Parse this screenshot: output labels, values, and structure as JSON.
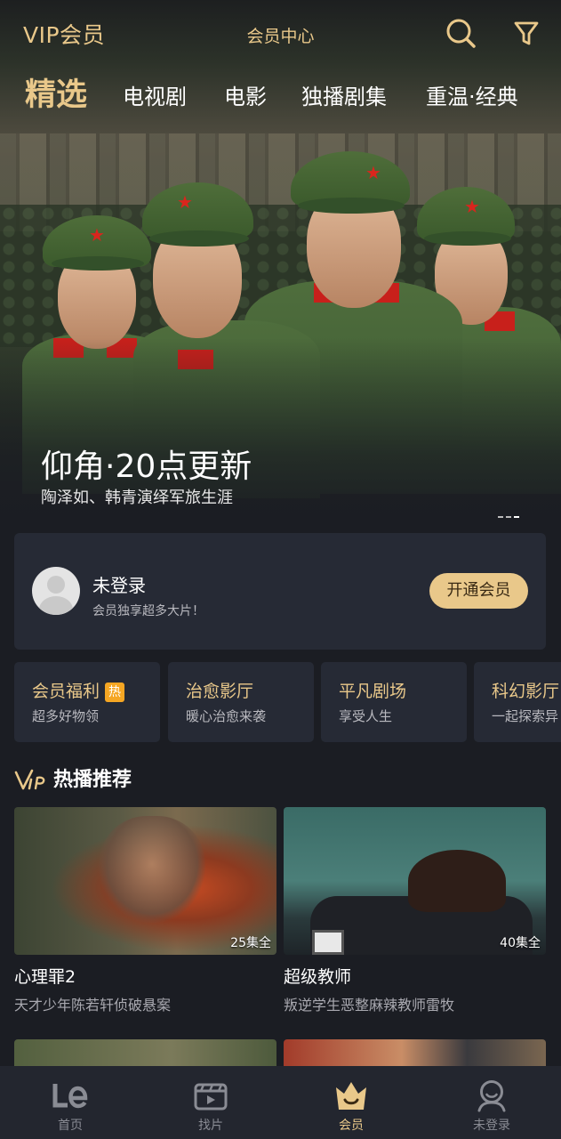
{
  "header": {
    "title": "VIP会员",
    "center_link": "会员中心",
    "search_icon": "search-icon",
    "filter_icon": "filter-icon",
    "accent_color": "#e9c88a"
  },
  "tabs": [
    {
      "label": "精选",
      "active": true
    },
    {
      "label": "电视剧",
      "active": false
    },
    {
      "label": "电影",
      "active": false
    },
    {
      "label": "独播剧集",
      "active": false
    },
    {
      "label": "重温·经典",
      "active": false
    }
  ],
  "banner": {
    "title": "仰角·20点更新",
    "subtitle": "陶泽如、韩青演绎军旅生涯",
    "slide_count": 3,
    "active_slide": 3
  },
  "login": {
    "name": "未登录",
    "description": "会员独享超多大片！",
    "button": "开通会员"
  },
  "categories": [
    {
      "title": "会员福利",
      "badge": "热",
      "subtitle": "超多好物领"
    },
    {
      "title": "治愈影厅",
      "subtitle": "暖心治愈来袭"
    },
    {
      "title": "平凡剧场",
      "subtitle": "享受人生"
    },
    {
      "title": "科幻影厅",
      "subtitle": "一起探索异"
    }
  ],
  "section": {
    "title": "热播推荐",
    "logo_icon": "vip-logo-icon"
  },
  "recommendations": [
    {
      "title": "心理罪2",
      "description": "天才少年陈若轩侦破悬案",
      "episodes": "25集全"
    },
    {
      "title": "超级教师",
      "description": "叛逆学生恶整麻辣教师雷牧",
      "episodes": "40集全"
    }
  ],
  "bottom_nav": [
    {
      "label": "首页",
      "icon": "le-logo-icon",
      "active": false
    },
    {
      "label": "找片",
      "icon": "clapperboard-icon",
      "active": false
    },
    {
      "label": "会员",
      "icon": "crown-icon",
      "active": true
    },
    {
      "label": "未登录",
      "icon": "user-icon",
      "active": false
    }
  ]
}
